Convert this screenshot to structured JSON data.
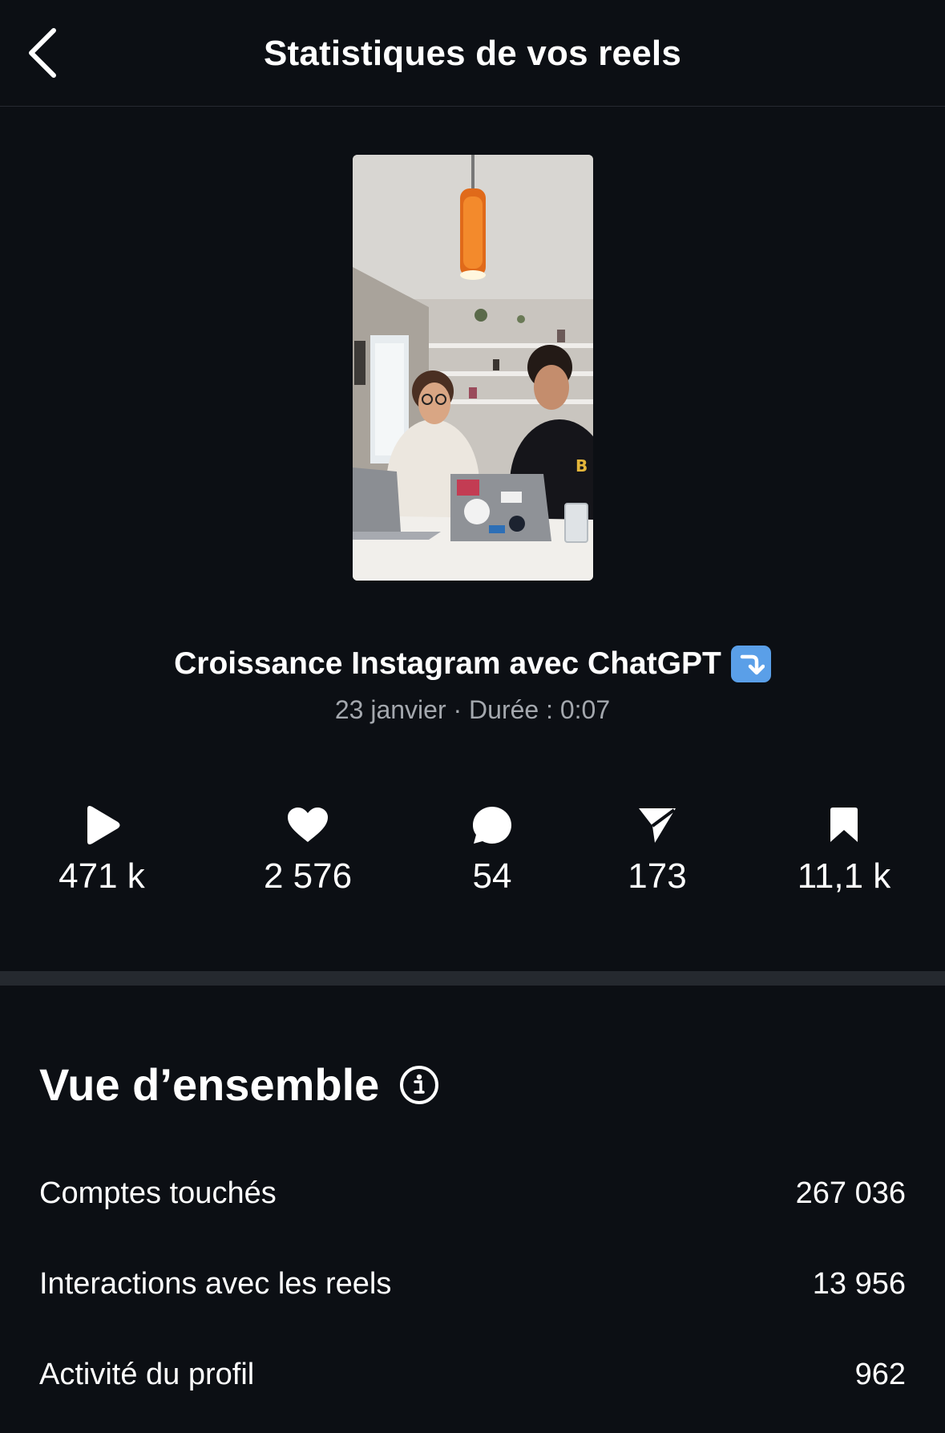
{
  "header": {
    "title": "Statistiques de vos reels",
    "back_icon": "chevron-left-icon"
  },
  "reel": {
    "title": "Croissance Instagram avec ChatGPT",
    "emoji": "arrow-down-right-box",
    "meta": "23 janvier · Durée : 0:07"
  },
  "stats": [
    {
      "icon": "play-icon",
      "value": "471 k"
    },
    {
      "icon": "heart-icon",
      "value": "2 576"
    },
    {
      "icon": "comment-icon",
      "value": "54"
    },
    {
      "icon": "share-icon",
      "value": "173"
    },
    {
      "icon": "bookmark-icon",
      "value": "11,1 k"
    }
  ],
  "overview": {
    "title": "Vue d’ensemble",
    "info_icon": "info-icon",
    "rows": [
      {
        "label": "Comptes touchés",
        "value": "267 036"
      },
      {
        "label": "Interactions avec les reels",
        "value": "13 956"
      },
      {
        "label": "Activité du profil",
        "value": "962"
      }
    ]
  },
  "colors": {
    "background": "#0c0f14",
    "muted_text": "#a4a8ae",
    "divider": "#25292f"
  }
}
